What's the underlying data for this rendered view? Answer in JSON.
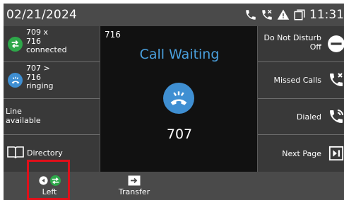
{
  "status": {
    "date": "02/21/2024",
    "time": "11:31"
  },
  "lines": [
    {
      "text_lines": [
        "709 x",
        "716",
        "connected"
      ],
      "icon": "transfer-arrows-icon",
      "color": "#2ea84a"
    },
    {
      "text_lines": [
        "707 >",
        "716",
        "ringing"
      ],
      "icon": "ringing-phone-icon",
      "color": "#3f8fd2"
    },
    {
      "text_lines": [
        "Line",
        "available"
      ]
    },
    {
      "label": "Directory",
      "icon": "book-icon"
    }
  ],
  "main": {
    "line_number": "716",
    "title": "Call Waiting",
    "caller": "707"
  },
  "right": [
    {
      "label_lines": [
        "Do Not Disturb",
        "Off"
      ],
      "icon": "dnd-minus-icon"
    },
    {
      "label_lines": [
        "Missed Calls"
      ],
      "icon": "missed-call-icon"
    },
    {
      "label_lines": [
        "Dialed"
      ],
      "icon": "dialed-call-icon"
    },
    {
      "label_lines": [
        "Next Page"
      ],
      "icon": "next-page-icon"
    }
  ],
  "softkeys": [
    {
      "label": "Left",
      "icon": "left-arrow-transfer-icon"
    },
    {
      "label": "Transfer",
      "icon": "transfer-icon"
    }
  ],
  "colors": {
    "accent_blue": "#3f8fd2",
    "green": "#2ea84a",
    "highlight": "#e0101a"
  }
}
